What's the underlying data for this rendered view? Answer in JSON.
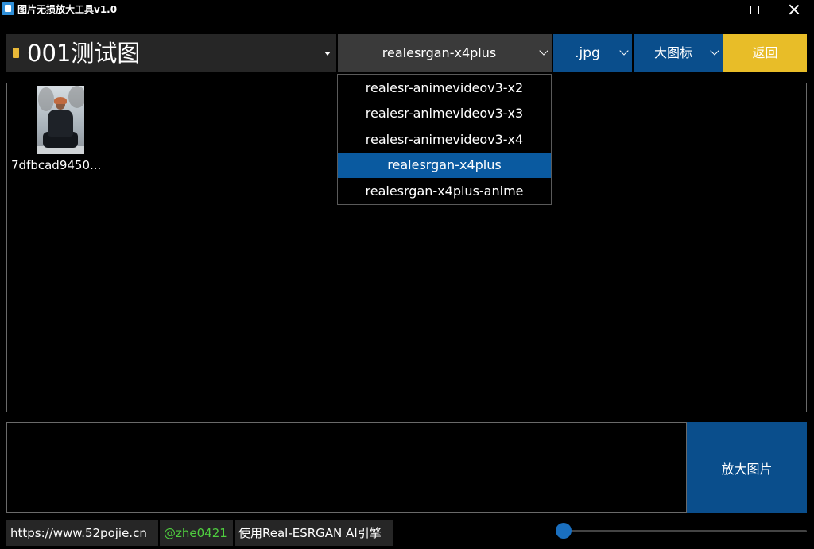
{
  "window": {
    "title": "图片无损放大工具v1.0",
    "controls": [
      "minimize-icon",
      "maximize-icon",
      "close-icon"
    ]
  },
  "toolbar": {
    "folder": {
      "label": "001测试图",
      "icon": "folder-icon"
    },
    "model": {
      "selected": "realesrgan-x4plus"
    },
    "extension": {
      "selected": ".jpg"
    },
    "view": {
      "selected": "大图标"
    },
    "back_label": "返回"
  },
  "model_dropdown": {
    "options": [
      "realesr-animevideov3-x2",
      "realesr-animevideov3-x3",
      "realesr-animevideov3-x4",
      "realesrgan-x4plus",
      "realesrgan-x4plus-anime"
    ],
    "selected_index": 3
  },
  "files": [
    {
      "name": "7dfbcad9450...",
      "thumbnail": "photo-thumbnail"
    }
  ],
  "actions": {
    "enlarge_label": "放大图片"
  },
  "footer": {
    "site": "https://www.52pojie.cn",
    "author": "@zhe0421",
    "engine": "使用Real-ESRGAN AI引擎",
    "author_color": "#4fcf3f"
  },
  "colors": {
    "accent_blue": "#0a4e8c",
    "selected_blue": "#0a5aa0",
    "back_yellow": "#e8bd28",
    "folder_yellow": "#e8b838",
    "slider_blue": "#1a6fbf"
  },
  "slider": {
    "value": 0
  }
}
